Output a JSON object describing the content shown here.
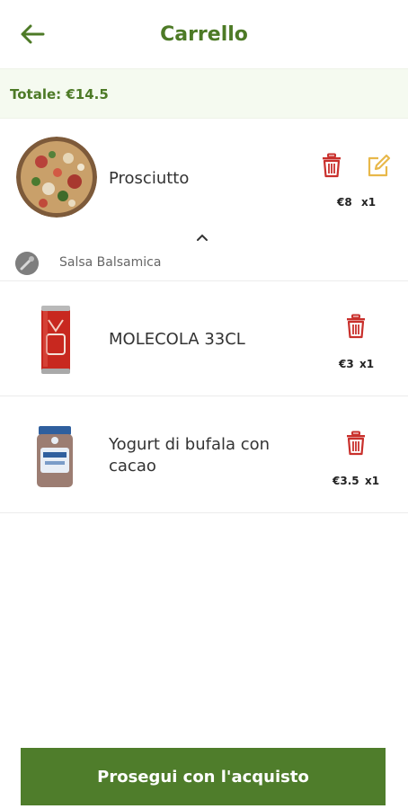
{
  "header": {
    "title": "Carrello",
    "back_icon": "arrow-left-icon"
  },
  "total": {
    "label": "Totale: €14.5"
  },
  "items": [
    {
      "name": "Prosciutto",
      "price": "€8",
      "qty": "x1",
      "image": "pizza-photo",
      "addon": {
        "label": "Salsa Balsamica",
        "icon": "sauce-icon"
      },
      "actions": [
        "trash-icon",
        "edit-icon"
      ]
    },
    {
      "name": "MOLECOLA 33CL",
      "price": "€3",
      "qty": "x1",
      "image": "cola-can-photo",
      "actions": [
        "trash-icon"
      ]
    },
    {
      "name": "Yogurt di bufala con cacao",
      "price": "€3.5",
      "qty": "x1",
      "image": "yogurt-jar-photo",
      "actions": [
        "trash-icon"
      ]
    }
  ],
  "cta": {
    "label": "Prosegui con l'acquisto"
  },
  "colors": {
    "brand_green": "#4d7a26",
    "trash_red": "#c9302c",
    "edit_yellow": "#e8b84a"
  }
}
